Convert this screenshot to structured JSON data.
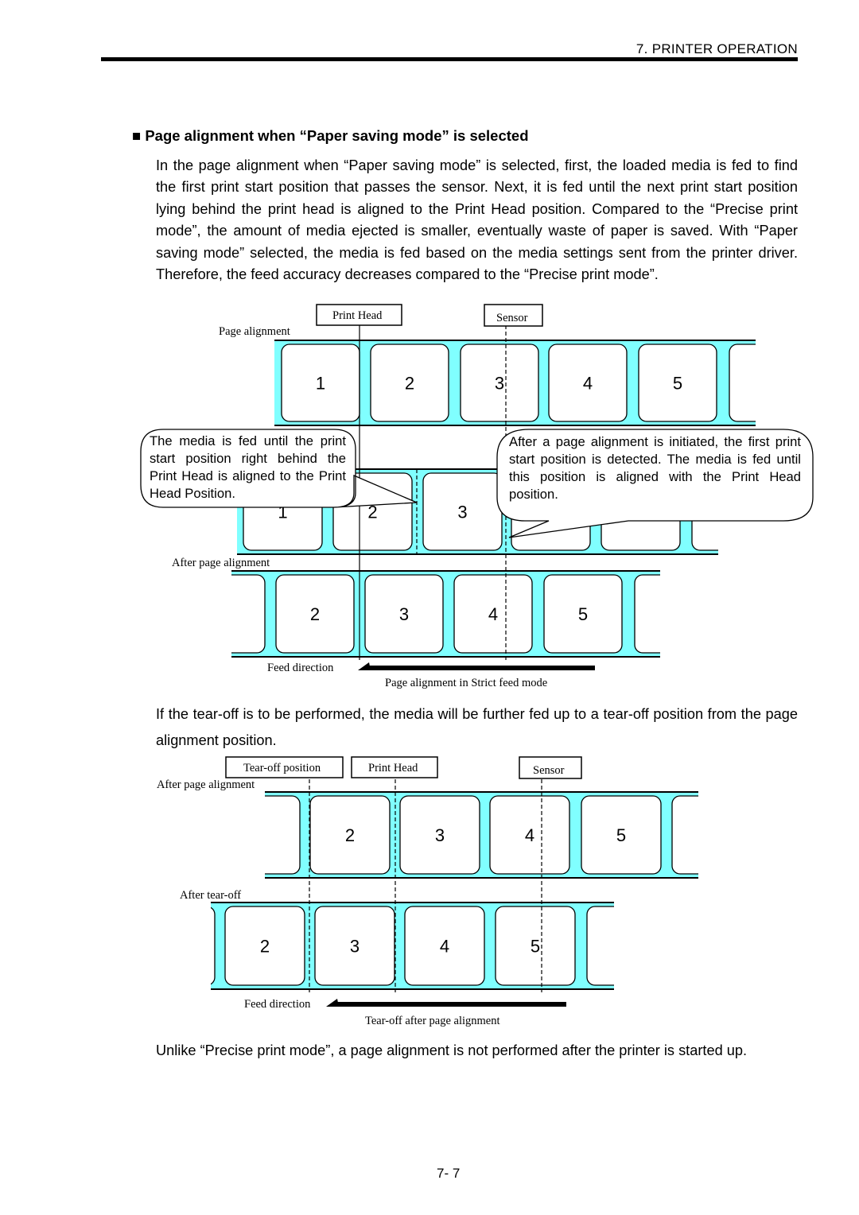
{
  "header": {
    "section": "7. PRINTER OPERATION"
  },
  "heading": "■ Page alignment when “Paper saving mode” is selected",
  "paragraphs": {
    "intro": "In the page alignment when “Paper saving mode” is selected, first, the loaded media is fed to find the first print start position that passes the sensor.   Next, it is fed until the next print start position lying behind the print head is aligned to the Print Head position.   Compared to the “Precise print mode”, the amount of media ejected is smaller, eventually waste of paper is saved. With “Paper saving mode” selected, the media is fed based on the media settings sent from the printer driver.   Therefore, the feed accuracy decreases compared to the “Precise print mode”.",
    "tearoff": "If the tear-off is to be performed, the media will be further fed up to a tear-off position from the page alignment position.",
    "closing": "Unlike “Precise print mode”, a page alignment is not performed after the printer is started up."
  },
  "diagram1": {
    "print_head_label": "Print Head",
    "sensor_label": "Sensor",
    "page_alignment_label": "Page alignment",
    "after_page_alignment_label": "After page alignment",
    "feed_direction_label": "Feed direction",
    "caption": "Page alignment in Strict feed mode",
    "callout_left": "The media is fed until the print start position right behind the Print Head is aligned to the Print Head Position.",
    "callout_right": "After a page alignment is initiated, the first print start position is detected.   The media is fed until this position is aligned with the Print Head position.",
    "strip_top_labels": [
      "1",
      "2",
      "3",
      "4",
      "5",
      ""
    ],
    "strip_middle_labels": [
      "1",
      "2",
      "3",
      "",
      "",
      ""
    ],
    "strip_bottom_labels": [
      "",
      "2",
      "3",
      "4",
      "5",
      ""
    ]
  },
  "diagram2": {
    "tearoff_position_label": "Tear-off position",
    "print_head_label": "Print Head",
    "sensor_label": "Sensor",
    "after_page_alignment_label": "After page alignment",
    "after_tearoff_label": "After tear-off",
    "feed_direction_label": "Feed direction",
    "caption": "Tear-off after page alignment",
    "strip_top_labels": [
      "",
      "2",
      "3",
      "4",
      "5",
      ""
    ],
    "strip_bottom_labels": [
      "",
      "2",
      "3",
      "4",
      "5",
      ""
    ]
  },
  "footer": {
    "page_number": "7- 7"
  },
  "colors": {
    "media_liner": "#80ffff"
  }
}
